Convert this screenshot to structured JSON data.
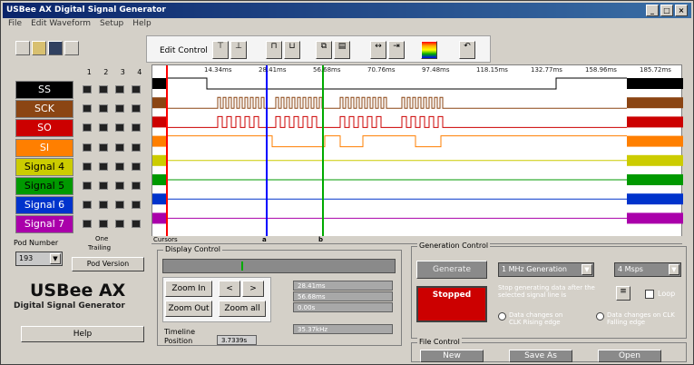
{
  "window": {
    "title": "USBee AX Digital Signal Generator"
  },
  "menu": [
    "File",
    "Edit Waveform",
    "Setup",
    "Help"
  ],
  "edit_control": {
    "label": "Edit Control"
  },
  "channel_numbers": [
    "1",
    "2",
    "3",
    "4"
  ],
  "channels": [
    {
      "label": "SS",
      "color": "#000000",
      "text_color": "#ffffff"
    },
    {
      "label": "SCK",
      "color": "#8b4513",
      "text_color": "#ffffff"
    },
    {
      "label": "SO",
      "color": "#cc0000",
      "text_color": "#ffffff"
    },
    {
      "label": "SI",
      "color": "#ff7f00",
      "text_color": "#ffffff"
    },
    {
      "label": "Signal 4",
      "color": "#cccc00",
      "text_color": "#000000"
    },
    {
      "label": "Signal 5",
      "color": "#009900",
      "text_color": "#000000"
    },
    {
      "label": "Signal 6",
      "color": "#0033cc",
      "text_color": "#ffffff"
    },
    {
      "label": "Signal 7",
      "color": "#aa00aa",
      "text_color": "#ffffff"
    }
  ],
  "time_labels": [
    "14.34ms",
    "28.41ms",
    "56.68ms",
    "70.76ms",
    "97.48ms",
    "118.15ms",
    "132.77ms",
    "158.96ms",
    "185.72ms"
  ],
  "left_panel": {
    "pod_number_label": "Pod Number",
    "pod_number_value": "193",
    "one_label": "One",
    "trailing_label": "Trailing",
    "pod_version_button": "Pod Version",
    "product_name": "USBee AX",
    "product_subtitle": "Digital Signal Generator",
    "help_button": "Help"
  },
  "cursors": {
    "label": "Cursors",
    "c1_label": "a",
    "c2_label": "b"
  },
  "display_control": {
    "title": "Display Control",
    "zoom_in": "Zoom In",
    "zoom_out": "Zoom Out",
    "zoom_all": "Zoom all",
    "prev": "<",
    "next": ">",
    "t1": "28.41ms",
    "t2": "56.68ms",
    "delta": "0.00s",
    "freq": "35.37kHz",
    "position_label": "Position",
    "position_value": "3.7339s",
    "timeline_label": "Timeline"
  },
  "generation_control": {
    "title": "Generation Control",
    "generate_button": "Generate",
    "status": "Stopped",
    "rate": "1 MHz Generation",
    "buffer": "4 Msps",
    "loop_text": "Stop generating data after the selected signal line is",
    "loop_label": "Loop",
    "option1": "Data changes on CLK Rising edge",
    "option2": "Data changes on CLK Falling edge"
  },
  "file_control": {
    "title": "File Control",
    "new_button": "New",
    "save_button": "Save As",
    "open_button": "Open"
  },
  "colors": {
    "cursor_blue": "#0000ff",
    "cursor_green": "#00aa00",
    "start_red": "#ff0000",
    "stopped_red": "#cc0000"
  }
}
